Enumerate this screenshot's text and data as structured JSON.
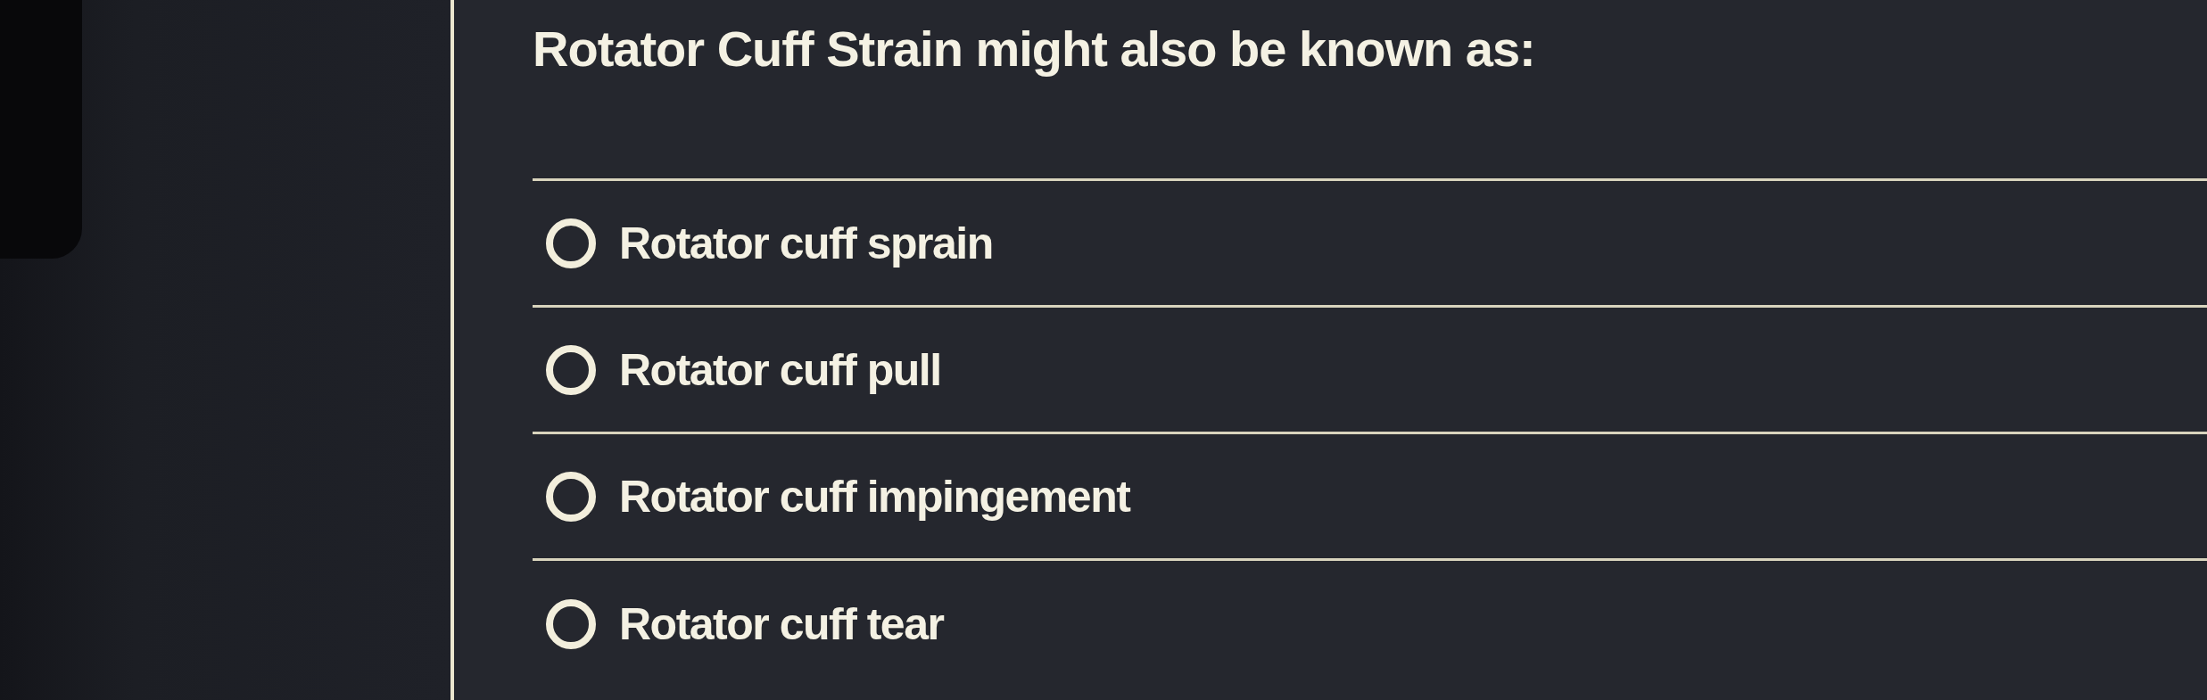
{
  "question": {
    "title": "Rotator Cuff Strain might also be known as:"
  },
  "options": [
    {
      "label": "Rotator cuff sprain",
      "selected": false
    },
    {
      "label": "Rotator cuff pull",
      "selected": false
    },
    {
      "label": "Rotator cuff impingement",
      "selected": false
    },
    {
      "label": "Rotator cuff tear",
      "selected": false
    }
  ]
}
